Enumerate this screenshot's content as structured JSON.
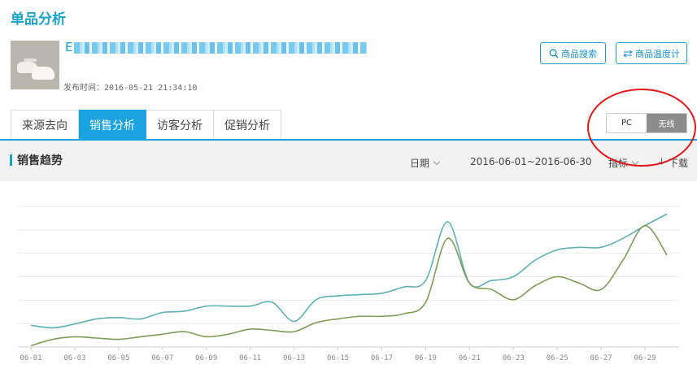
{
  "page": {
    "title": "单品分析"
  },
  "product": {
    "title_visible": "E",
    "publish_time": "发布时间：2016-05-21 21:34:10"
  },
  "actions": {
    "search_label": "商品搜索",
    "thermometer_label": "商品温度计"
  },
  "tabs": [
    {
      "label": "来源去向",
      "active": false
    },
    {
      "label": "销售分析",
      "active": true
    },
    {
      "label": "访客分析",
      "active": false
    },
    {
      "label": "促销分析",
      "active": false
    }
  ],
  "device_toggle": {
    "options": [
      "PC",
      "无线"
    ],
    "selected": "无线"
  },
  "section": {
    "title": "销售趋势",
    "date_label": "日期",
    "date_range": "2016-06-01~2016-06-30",
    "metric_label": "指标",
    "download_label": "下载"
  },
  "colors": {
    "accent": "#1aa3e0",
    "series_teal": "#5fb0b2",
    "series_olive": "#7f9b58",
    "annotation_red": "#e0181b"
  },
  "chart_data": {
    "type": "line",
    "x": [
      "06-01",
      "06-02",
      "06-03",
      "06-04",
      "06-05",
      "06-06",
      "06-07",
      "06-08",
      "06-09",
      "06-10",
      "06-11",
      "06-12",
      "06-13",
      "06-14",
      "06-15",
      "06-16",
      "06-17",
      "06-18",
      "06-19",
      "06-20",
      "06-21",
      "06-22",
      "06-23",
      "06-24",
      "06-25",
      "06-26",
      "06-27",
      "06-28",
      "06-29",
      "06-30"
    ],
    "x_tick_labels": [
      "06-01",
      "06-03",
      "06-05",
      "06-07",
      "06-09",
      "06-11",
      "06-13",
      "06-15",
      "06-17",
      "06-19",
      "06-21",
      "06-23",
      "06-25",
      "06-27",
      "06-29"
    ],
    "series": [
      {
        "values": [
          17,
          15,
          18,
          22,
          23,
          22,
          27,
          28,
          32,
          32,
          32,
          35,
          20,
          37,
          40,
          41,
          42,
          47,
          52,
          98,
          50,
          52,
          55,
          68,
          76,
          78,
          78,
          85,
          95,
          104
        ]
      },
      {
        "values": [
          1,
          6,
          8,
          7,
          6,
          8,
          10,
          12,
          8,
          10,
          14,
          13,
          12,
          19,
          22,
          24,
          24,
          26,
          35,
          85,
          50,
          45,
          37,
          48,
          55,
          50,
          45,
          68,
          95,
          72
        ]
      }
    ],
    "ylim": [
      0,
      110
    ],
    "grid": true,
    "legend": "none"
  }
}
